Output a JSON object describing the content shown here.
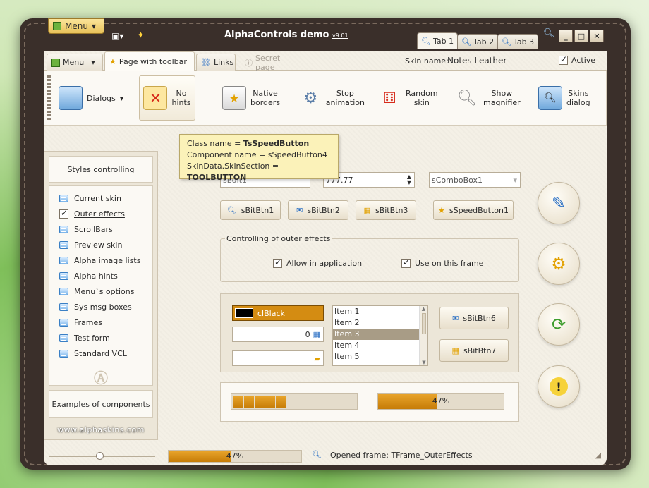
{
  "app": {
    "title": "AlphaControls demo",
    "version": "v9.01",
    "menu_label": "Menu",
    "caption_buttons": [
      "_",
      "□",
      "✕"
    ]
  },
  "title_tabs": [
    "Tab 1",
    "Tab 2",
    "Tab 3"
  ],
  "page_tabs": {
    "menu": "Menu",
    "page_with_toolbar": "Page with toolbar",
    "links": "Links",
    "secret": "Secret page"
  },
  "skin": {
    "label": "Skin name:",
    "value": "Notes Leather",
    "active_label": "Active"
  },
  "toolbar": {
    "dialogs": "Dialogs",
    "no_hints": [
      "No",
      "hints"
    ],
    "native_borders": [
      "Native",
      "borders"
    ],
    "stop_animation": [
      "Stop",
      "animation"
    ],
    "random_skin": [
      "Random",
      "skin"
    ],
    "show_magnifier": [
      "Show",
      "magnifier"
    ],
    "skins_dialog": [
      "Skins",
      "dialog"
    ]
  },
  "hint": {
    "line1_prefix": "Class name = ",
    "line1_value": "TsSpeedButton",
    "line2": "Component name = sSpeedButton4",
    "line3_prefix": "SkinData.SkinSection = ",
    "line3_value": "TOOLBUTTON"
  },
  "sidebar": {
    "header": "Styles controlling",
    "items": [
      "Current skin",
      "Outer effects",
      "ScrollBars",
      "Preview skin",
      "Alpha image lists",
      "Alpha hints",
      "Menu`s options",
      "Sys msg boxes",
      "Frames",
      "Test form",
      "Standard VCL"
    ],
    "examples": "Examples of components",
    "website": "www.alphaskins.com"
  },
  "editors": {
    "edit": "sEdit1",
    "spin": "777.77",
    "combo": "sComboBox1"
  },
  "buttons": [
    "sBitBtn1",
    "sBitBtn2",
    "sBitBtn3",
    "sSpeedButton1"
  ],
  "outer_group": {
    "title": "Controlling of outer effects",
    "allow": "Allow in application",
    "use": "Use on this frame"
  },
  "lower": {
    "color": "clBlack",
    "calc_value": "0",
    "list_items": [
      "Item 1",
      "Item 2",
      "Item 3",
      "Item 4",
      "Item 5"
    ],
    "selected_index": 2,
    "btn6": "sBitBtn6",
    "btn7": "sBitBtn7"
  },
  "progress": {
    "seg_count": 5,
    "percent_text": "47%",
    "percent": 47
  },
  "status": {
    "percent_text": "47%",
    "opened": "Opened frame: TFrame_OuterEffects"
  },
  "colors": {
    "accent": "#d48c12",
    "leather": "#3a2f2a",
    "hint_bg": "#fbf2b9"
  }
}
